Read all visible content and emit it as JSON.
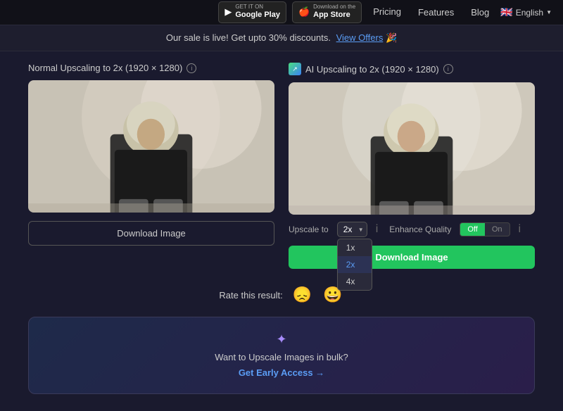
{
  "navbar": {
    "google_play_sub": "GET IT ON",
    "google_play_main": "Google Play",
    "app_store_sub": "Download on the",
    "app_store_main": "App Store",
    "pricing": "Pricing",
    "features": "Features",
    "blog": "Blog",
    "language": "English"
  },
  "sale_banner": {
    "text": "Our sale is live! Get upto 30% discounts.",
    "link_text": "View Offers",
    "emoji": "🎉"
  },
  "left_panel": {
    "title": "Normal Upscaling to 2x (1920 × 1280)",
    "download_label": "Download Image"
  },
  "right_panel": {
    "title": "AI Upscaling to 2x (1920 × 1280)",
    "upscale_label": "Upscale to",
    "upscale_value": "2x",
    "upscale_options": [
      "1x",
      "2x",
      "4x"
    ],
    "enhance_quality_label": "Enhance Quality",
    "toggle_off": "Off",
    "toggle_on": "On",
    "download_label": "Download Image"
  },
  "rating": {
    "label": "Rate this result:",
    "sad_emoji": "😞",
    "happy_emoji": "😀"
  },
  "bulk_cta": {
    "icon": "✦",
    "text": "Want to Upscale Images in bulk?",
    "link_text": "Get Early Access →"
  }
}
